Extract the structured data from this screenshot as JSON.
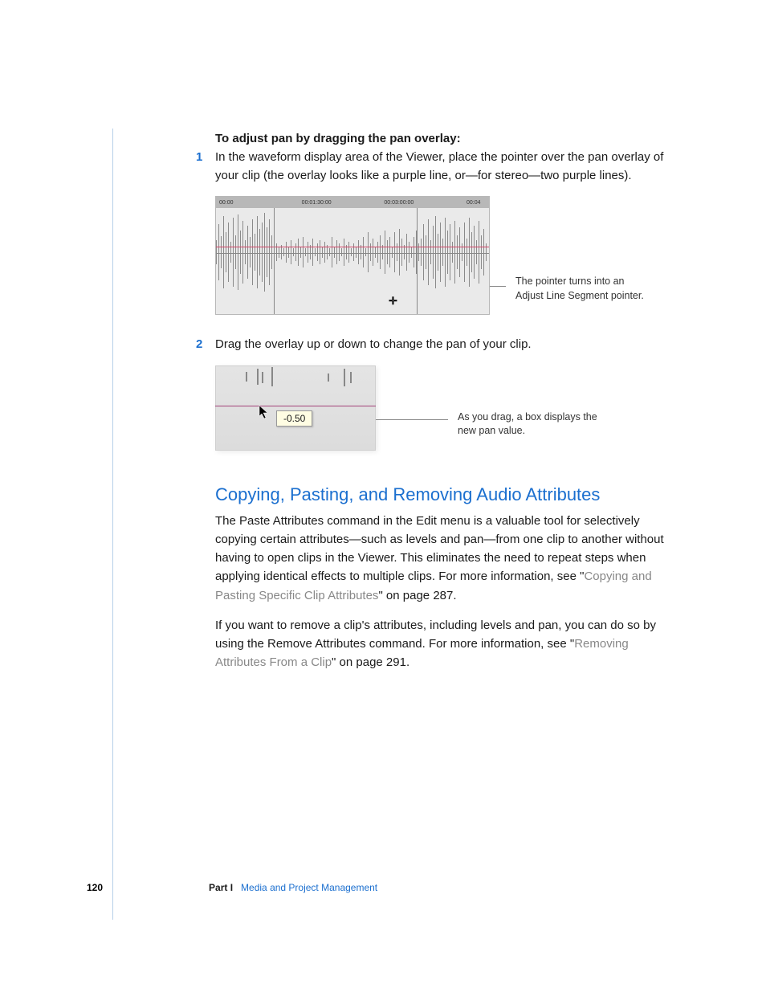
{
  "heading_bold": "To adjust pan by dragging the pan overlay:",
  "steps": [
    {
      "num": "1",
      "text": "In the waveform display area of the Viewer, place the pointer over the pan overlay of your clip (the overlay looks like a purple line, or—for stereo—two purple lines)."
    },
    {
      "num": "2",
      "text": "Drag the overlay up or down to change the pan of your clip."
    }
  ],
  "fig1": {
    "timecodes": [
      "00:00",
      "00:01:30:00",
      "00:03:00:00",
      "00:04"
    ],
    "caption": "The pointer turns into an Adjust Line Segment pointer."
  },
  "fig2": {
    "value": "-0.50",
    "caption": "As you drag, a box displays the new pan value."
  },
  "section_title": "Copying, Pasting, and Removing Audio Attributes",
  "para1_a": "The Paste Attributes command in the Edit menu is a valuable tool for selectively copying certain attributes—such as levels and pan—from one clip to another without having to open clips in the Viewer. This eliminates the need to repeat steps when applying identical effects to multiple clips. For more information, see \"",
  "para1_link": "Copying and Pasting Specific Clip Attributes",
  "para1_b": "\" on page 287.",
  "para2_a": "If you want to remove a clip's attributes, including levels and pan, you can do so by using the Remove Attributes command. For more information, see \"",
  "para2_link": "Removing Attributes From a Clip",
  "para2_b": "\" on page 291.",
  "footer": {
    "page": "120",
    "part_label": "Part I",
    "part_title": "Media and Project Management"
  }
}
